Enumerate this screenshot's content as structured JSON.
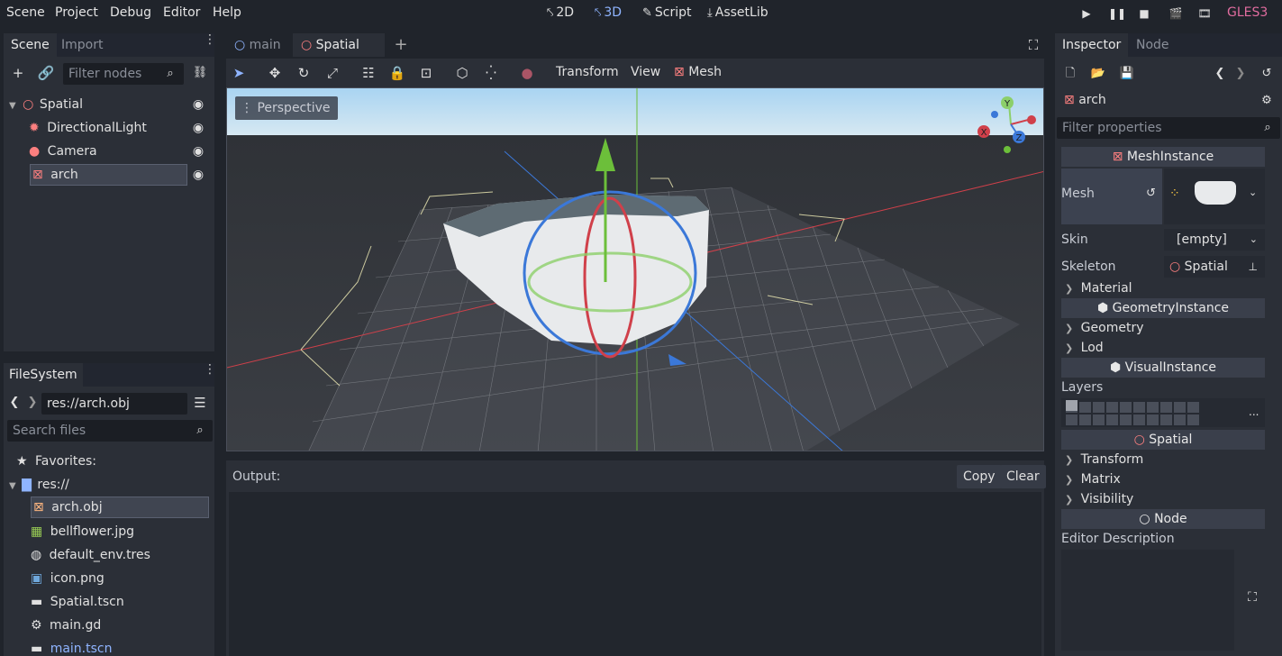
{
  "menu": [
    "Scene",
    "Project",
    "Debug",
    "Editor",
    "Help"
  ],
  "workspaces": [
    {
      "label": "2D",
      "icon": "2d-icon"
    },
    {
      "label": "3D",
      "icon": "3d-icon"
    },
    {
      "label": "Script",
      "icon": "script-icon"
    },
    {
      "label": "AssetLib",
      "icon": "assetlib-icon"
    }
  ],
  "renderer": "GLES3",
  "scene_dock": {
    "tabs": [
      "Scene",
      "Import"
    ],
    "filter_placeholder": "Filter nodes",
    "nodes": [
      "Spatial",
      "DirectionalLight",
      "Camera",
      "arch"
    ]
  },
  "filesystem_dock": {
    "tab": "FileSystem",
    "path": "res://arch.obj",
    "search_placeholder": "Search files",
    "favorites_label": "Favorites:",
    "root": "res://",
    "files": [
      "arch.obj",
      "bellflower.jpg",
      "default_env.tres",
      "icon.png",
      "Spatial.tscn",
      "main.gd",
      "main.tscn"
    ]
  },
  "editor_tabs": [
    "main",
    "Spatial"
  ],
  "toolbar": {
    "transform_label": "Transform",
    "view_label": "View",
    "mesh_label": "Mesh"
  },
  "viewport": {
    "mode_label": "Perspective",
    "gizmo": {
      "y": "Y",
      "x": "X",
      "z": "Z"
    }
  },
  "output": {
    "title": "Output:",
    "copy_label": "Copy",
    "clear_label": "Clear"
  },
  "inspector": {
    "tabs": [
      "Inspector",
      "Node"
    ],
    "object_name": "arch",
    "filter_placeholder": "Filter properties",
    "mesh_instance_header": "MeshInstance",
    "mesh_label": "Mesh",
    "skin_label": "Skin",
    "skin_value": "[empty]",
    "skeleton_label": "Skeleton",
    "skeleton_value": "Spatial",
    "material_label": "Material",
    "geometry_instance_header": "GeometryInstance",
    "geometry_label": "Geometry",
    "lod_label": "Lod",
    "visual_instance_header": "VisualInstance",
    "layers_label": "Layers",
    "layers_more": "...",
    "spatial_header": "Spatial",
    "transform_label": "Transform",
    "matrix_label": "Matrix",
    "visibility_label": "Visibility",
    "node_header": "Node",
    "editor_description_label": "Editor Description"
  },
  "colors": {
    "accent": "#8fb4ff",
    "node3d_icon": "#fc7f7f",
    "renderer": "#e06c9f",
    "mesh_icon": "#fc7f7f"
  }
}
